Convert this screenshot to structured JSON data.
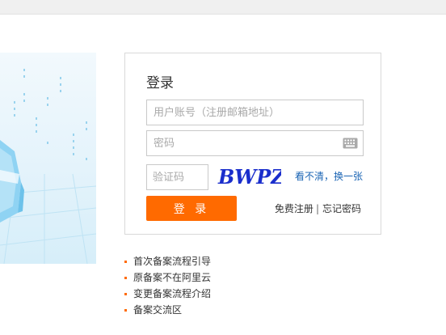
{
  "login": {
    "title": "登录",
    "username_placeholder": "用户账号（注册邮箱地址）",
    "password_placeholder": "密码",
    "captcha_placeholder": "验证码",
    "captcha_text": "BWPZ",
    "refresh_captcha": "看不清，换一张",
    "submit_label": "登 录",
    "register_label": "免费注册",
    "separator": "|",
    "forgot_label": "忘记密码"
  },
  "help_links": [
    "首次备案流程引导",
    "原备案不在阿里云",
    "变更备案流程介绍",
    "备案交流区"
  ],
  "colors": {
    "accent": "#ff6a00",
    "link": "#1a64b4",
    "captcha": "#1a2ecc"
  }
}
